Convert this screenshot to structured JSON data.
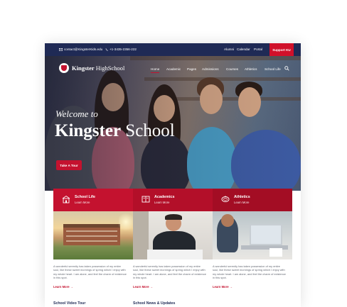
{
  "topbar": {
    "email": "contact@KingsterKids.edu",
    "phone": "+1-3435-2356-222",
    "links": [
      "Alumni",
      "Calendar",
      "Portal"
    ],
    "support_label": "Support KU"
  },
  "brand": {
    "name_bold": "Kingster",
    "name_light": "HighSchool"
  },
  "nav": [
    "Home",
    "Academic",
    "Pages",
    "Admissions",
    "Courses",
    "Athletics",
    "School Life"
  ],
  "hero": {
    "welcome": "Welcome to",
    "title_bold": "Kingster",
    "title_light": "School",
    "tour_button": "Take A Tour"
  },
  "features": [
    {
      "title": "School Life",
      "link": "Learn More",
      "icon": "school-building-icon"
    },
    {
      "title": "Academics",
      "link": "Learn More",
      "icon": "book-icon"
    },
    {
      "title": "Athletics",
      "link": "Learn More",
      "icon": "stadium-icon"
    }
  ],
  "columns": [
    {
      "text": "A wonderful serenity has taken possession of my entire soul, like these sweet mornings of spring which I enjoy with my whole heart. I am alone, and feel the charm of existence in this spot.",
      "link": "Learn More →"
    },
    {
      "text": "A wonderful serenity has taken possession of my entire soul, like these sweet mornings of spring which I enjoy with my whole heart. I am alone, and feel the charm of existence in this spot.",
      "link": "Learn More →"
    },
    {
      "text": "A wonderful serenity has taken possession of my entire soul, like these sweet mornings of spring which I enjoy with my whole heart. I am alone, and feel the charm of existence in this spot.",
      "link": "Learn More →"
    }
  ],
  "bottom_headings": [
    "School Video Tour",
    "School News & Updates",
    ""
  ],
  "colors": {
    "navy": "#1f2a55",
    "accent": "#c4122f"
  }
}
